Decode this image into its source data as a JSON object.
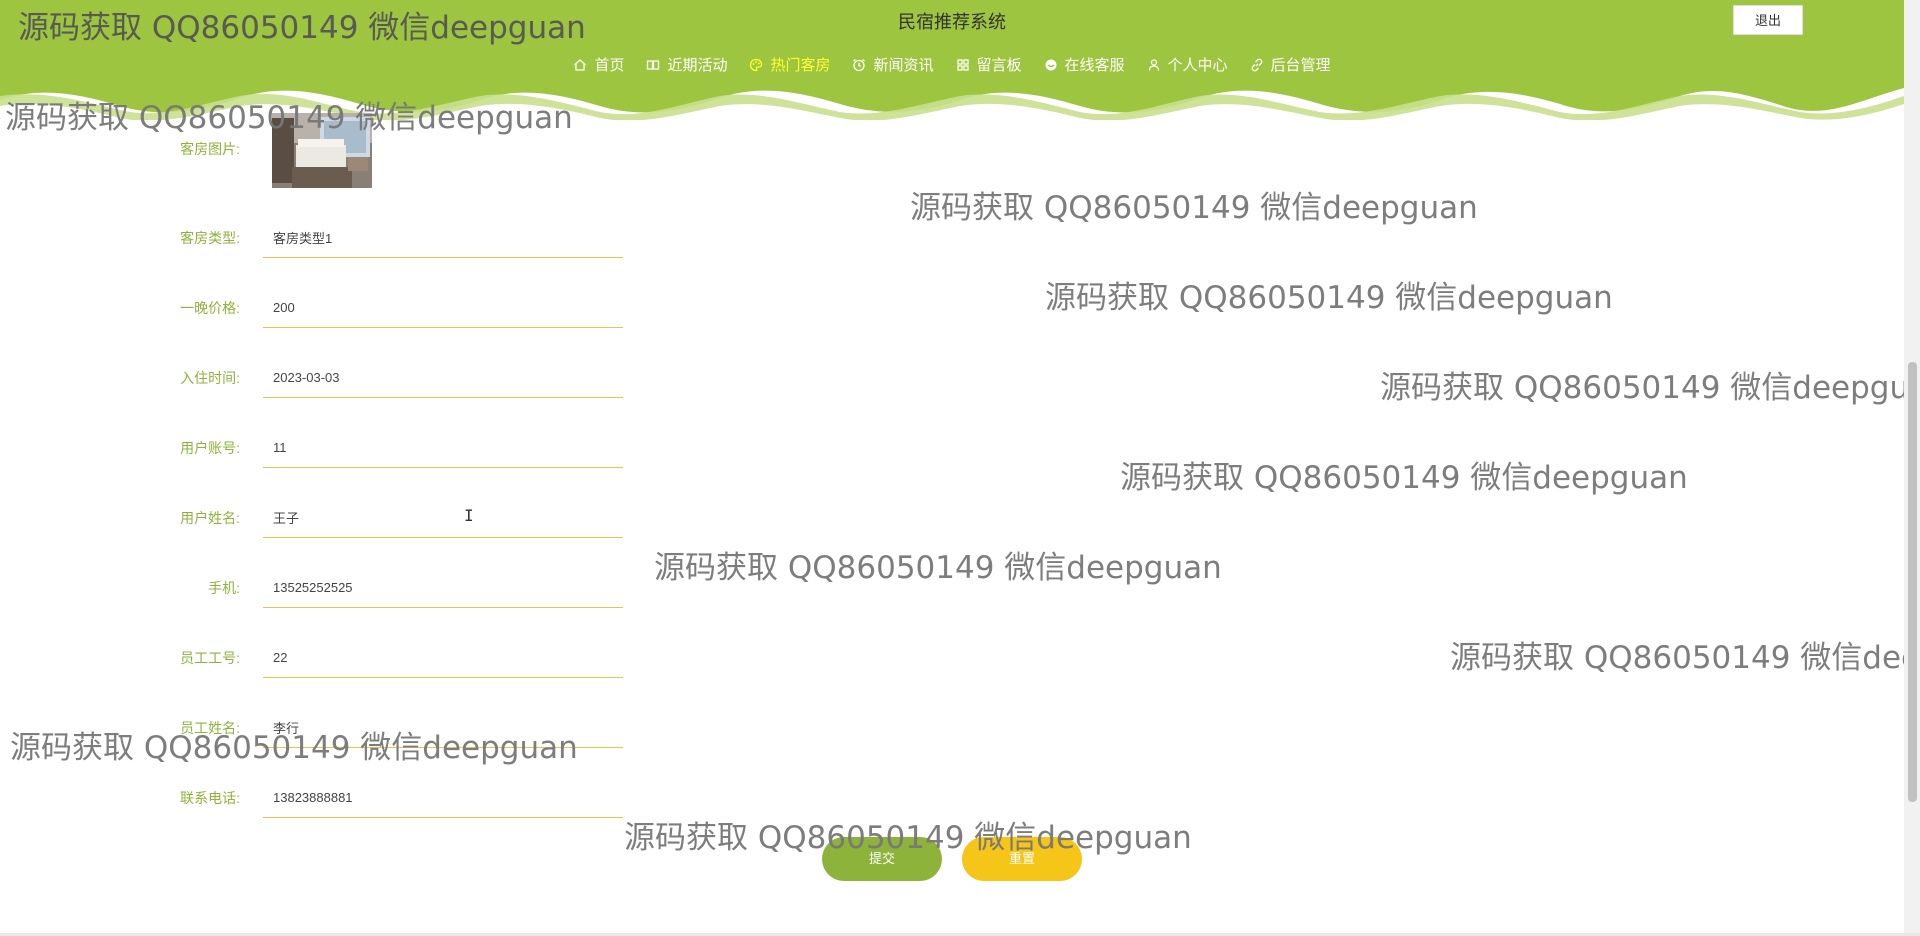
{
  "header": {
    "site_title": "民宿推荐系统",
    "logout_label": "退出",
    "nav": [
      {
        "label": "首页",
        "icon": "home-icon",
        "active": false
      },
      {
        "label": "近期活动",
        "icon": "book-icon",
        "active": false
      },
      {
        "label": "热门客房",
        "icon": "palette-icon",
        "active": true
      },
      {
        "label": "新闻资讯",
        "icon": "alarm-icon",
        "active": false
      },
      {
        "label": "留言板",
        "icon": "grid-icon",
        "active": false
      },
      {
        "label": "在线客服",
        "icon": "chat-icon",
        "active": false
      },
      {
        "label": "个人中心",
        "icon": "user-icon",
        "active": false
      },
      {
        "label": "后台管理",
        "icon": "link-icon",
        "active": false
      }
    ]
  },
  "form": {
    "room_image_label": "客房图片:",
    "fields": [
      {
        "label": "客房类型:",
        "value": "客房类型1"
      },
      {
        "label": "一晚价格:",
        "value": "200"
      },
      {
        "label": "入住时间:",
        "value": "2023-03-03"
      },
      {
        "label": "用户账号:",
        "value": "11"
      },
      {
        "label": "用户姓名:",
        "value": "王子"
      },
      {
        "label": "手机:",
        "value": "13525252525"
      },
      {
        "label": "员工工号:",
        "value": "22"
      },
      {
        "label": "员工姓名:",
        "value": "李行"
      },
      {
        "label": "联系电话:",
        "value": "13823888881"
      }
    ],
    "submit_label": "提交",
    "reset_label": "重置"
  },
  "watermark_text": "源码获取 QQ86050149 微信deepguan",
  "colors": {
    "header_green": "#9dc53f",
    "accent_green": "#8db33a",
    "accent_yellow": "#f5c518",
    "active_nav": "#ffff33"
  }
}
